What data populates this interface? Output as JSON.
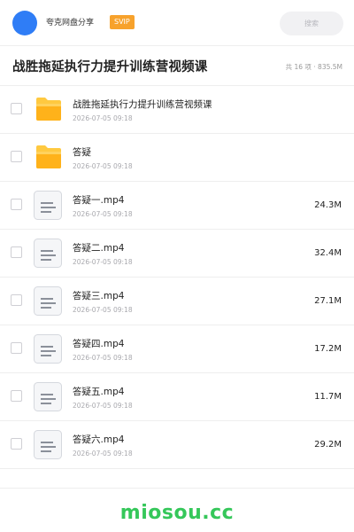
{
  "header": {
    "user_name": "夸克网盘分享",
    "vip_badge": "SVIP",
    "search_label": "搜索"
  },
  "title_bar": {
    "title": "战胜拖延执行力提升训练营视频课",
    "summary": "共 16 项 · 835.5M"
  },
  "items": [
    {
      "type": "folder",
      "icon": "folder-icon",
      "name": "战胜拖延执行力提升训练营视频课",
      "date": "2026-07-05 09:18",
      "size": ""
    },
    {
      "type": "folder",
      "icon": "folder-icon",
      "name": "答疑",
      "date": "2026-07-05 09:18",
      "size": ""
    },
    {
      "type": "file",
      "icon": "video-file-icon",
      "name": "答疑一.mp4",
      "date": "2026-07-05 09:18",
      "size": "24.3M"
    },
    {
      "type": "file",
      "icon": "video-file-icon",
      "name": "答疑二.mp4",
      "date": "2026-07-05 09:18",
      "size": "32.4M"
    },
    {
      "type": "file",
      "icon": "video-file-icon",
      "name": "答疑三.mp4",
      "date": "2026-07-05 09:18",
      "size": "27.1M"
    },
    {
      "type": "file",
      "icon": "video-file-icon",
      "name": "答疑四.mp4",
      "date": "2026-07-05 09:18",
      "size": "17.2M"
    },
    {
      "type": "file",
      "icon": "video-file-icon",
      "name": "答疑五.mp4",
      "date": "2026-07-05 09:18",
      "size": "11.7M"
    },
    {
      "type": "file",
      "icon": "video-file-icon",
      "name": "答疑六.mp4",
      "date": "2026-07-05 09:18",
      "size": "29.2M"
    }
  ],
  "footer": {
    "watermark": "miosou.cc"
  },
  "colors": {
    "avatar": "#2f7df6",
    "vip_badge": "#f7a22c",
    "folder": "#ffc940",
    "watermark": "#35c75a"
  }
}
